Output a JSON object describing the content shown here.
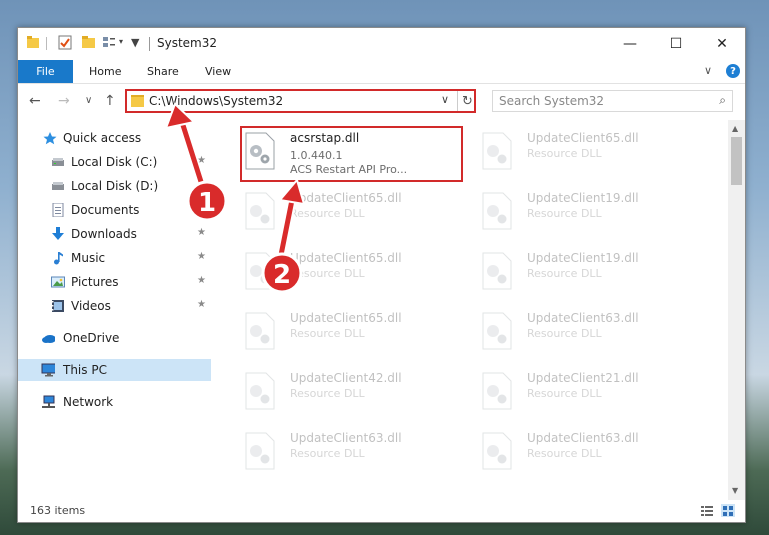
{
  "window": {
    "title": "System32",
    "qa_toolbar_chevron": "▾",
    "controls": {
      "minimize": "—",
      "maximize": "☐",
      "close": "✕"
    }
  },
  "ribbon": {
    "file": "File",
    "tabs": [
      "Home",
      "Share",
      "View"
    ],
    "expand_chevron": "∨",
    "help": "?"
  },
  "nav": {
    "back": "←",
    "forward": "→",
    "recent": "∨",
    "up": "↑",
    "address": "C:\\Windows\\System32",
    "address_chevron": "∨",
    "refresh": "↻",
    "search_placeholder": "Search System32",
    "search_icon_glyph": "⌕"
  },
  "sidebar": {
    "pin_glyph": "★",
    "items": [
      {
        "label": "Quick access",
        "icon": "star-icon"
      },
      {
        "label": "Local Disk (C:)",
        "icon": "drive-icon"
      },
      {
        "label": "Local Disk (D:)",
        "icon": "drive-icon"
      },
      {
        "label": "Documents",
        "icon": "documents-icon"
      },
      {
        "label": "Downloads",
        "icon": "downloads-icon"
      },
      {
        "label": "Music",
        "icon": "music-icon"
      },
      {
        "label": "Pictures",
        "icon": "pictures-icon"
      },
      {
        "label": "Videos",
        "icon": "videos-icon"
      },
      {
        "label": "OneDrive",
        "icon": "cloud-icon"
      },
      {
        "label": "This PC",
        "icon": "computer-icon"
      },
      {
        "label": "Network",
        "icon": "network-icon"
      }
    ]
  },
  "files": {
    "selected": {
      "name": "acsrstap.dll",
      "version": "1.0.440.1",
      "description": "ACS Restart API Pro..."
    },
    "others": [
      {
        "name": "UpdateClient65.dll",
        "type": "Resource DLL"
      },
      {
        "name": "UpdateClient65.dll",
        "type": "Resource DLL"
      },
      {
        "name": "UpdateClient19.dll",
        "type": "Resource DLL"
      },
      {
        "name": "UpdateClient65.dll",
        "type": "Resource DLL"
      },
      {
        "name": "UpdateClient19.dll",
        "type": "Resource DLL"
      },
      {
        "name": "UpdateClient65.dll",
        "type": "Resource DLL"
      },
      {
        "name": "UpdateClient63.dll",
        "type": "Resource DLL"
      },
      {
        "name": "UpdateClient42.dll",
        "type": "Resource DLL"
      },
      {
        "name": "UpdateClient21.dll",
        "type": "Resource DLL"
      },
      {
        "name": "UpdateClient63.dll",
        "type": "Resource DLL"
      },
      {
        "name": "UpdateClient63.dll",
        "type": "Resource DLL"
      }
    ]
  },
  "status": {
    "item_count": "163 items"
  },
  "annotations": {
    "step1": "1",
    "step2": "2"
  },
  "colors": {
    "accent": "#1979ca",
    "highlight": "#d22a2a",
    "selection": "#cce4f7"
  }
}
